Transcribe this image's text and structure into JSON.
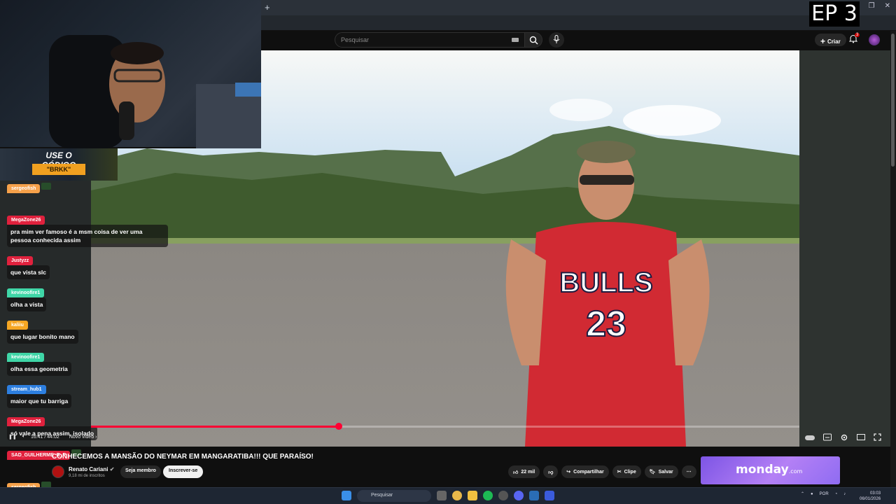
{
  "overlay": {
    "episode": "EP 3",
    "promo_title": "USE O CÓDIGO",
    "promo_code": "\"BRKK\""
  },
  "browser": {
    "newtab_icon": "plus-icon"
  },
  "header": {
    "search_placeholder": "Pesquisar",
    "create_label": "Criar",
    "notif_count": "3"
  },
  "chat": [
    {
      "user": "sergeofish",
      "text": "",
      "color": "#f6a14a"
    },
    {
      "user": "MegaZone26",
      "text": "pra mim ver famoso é a msm coisa de ver uma pessoa conhecida assim",
      "color": "#e0213d"
    },
    {
      "user": "Justyzz",
      "text": "que vista slc",
      "color": "#e0213d"
    },
    {
      "user": "kevinoofire1",
      "text": "olha a vista",
      "color": "#3fd6a7"
    },
    {
      "user": "kaliiu",
      "text": "que lugar bonito mano",
      "color": "#f5a623"
    },
    {
      "user": "kevinoofire1",
      "text": "olha essa geometria",
      "color": "#3fd6a7"
    },
    {
      "user": "stream_hub1",
      "text": "maior que tu barriga",
      "color": "#2d7fe0"
    },
    {
      "user": "MegaZone26",
      "text": "só vale a pena assim, isolado",
      "color": "#e0213d"
    },
    {
      "user": "SAD_GUILHERME_R_P",
      "text": "",
      "color": "#e0213d"
    },
    {
      "user": "sergeofish",
      "text": "",
      "color": "#f6a14a"
    }
  ],
  "player": {
    "time": "16:41 / 44:02",
    "next_label": "Novo vídeo",
    "progress": 0.35
  },
  "video": {
    "title": "CONHECEMOS A MANSÃO DO NEYMAR EM MANGARATIBA!!! QUE PARAÍSO!",
    "channel": "Renato Cariani",
    "subscribers": "9,18 mi de inscritos",
    "member_label": "Seja membro",
    "subscribe_label": "Inscrever-se",
    "likes": "22 mil",
    "share_label": "Compartilhar",
    "clip_label": "Clipe",
    "save_label": "Salvar"
  },
  "ad": {
    "brand": "monday",
    "suffix": ".com"
  },
  "taskbar": {
    "search_label": "Pesquisar",
    "lang": "POR",
    "time": "03:03",
    "date": "06/01/2026"
  }
}
